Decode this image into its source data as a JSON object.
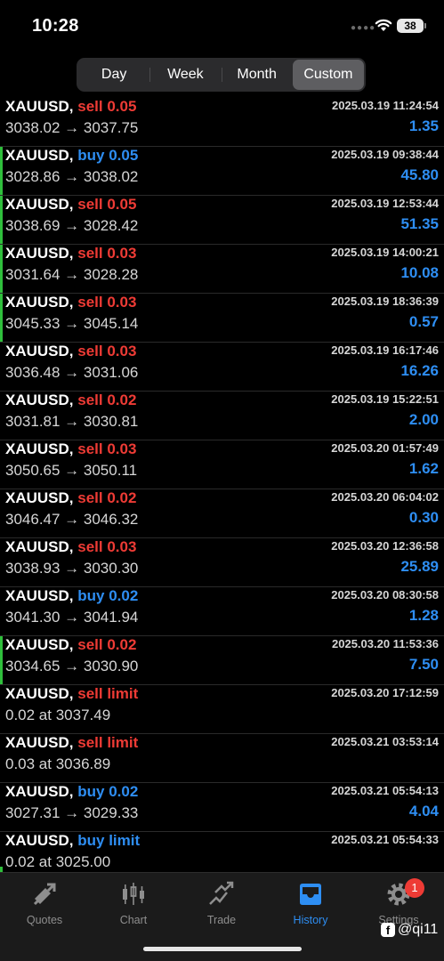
{
  "status": {
    "time": "10:28",
    "battery": "38"
  },
  "filters": [
    {
      "label": "Day",
      "active": false
    },
    {
      "label": "Week",
      "active": false
    },
    {
      "label": "Month",
      "active": false
    },
    {
      "label": "Custom",
      "active": true
    }
  ],
  "trades": [
    {
      "symbol": "XAUUSD,",
      "side": "sell",
      "side_text": "sell 0.05",
      "detail": "3038.02 → 3037.75",
      "time": "2025.03.19 11:24:54",
      "profit": "1.35",
      "flag": false
    },
    {
      "symbol": "XAUUSD,",
      "side": "buy",
      "side_text": "buy 0.05",
      "detail": "3028.86 → 3038.02",
      "time": "2025.03.19 09:38:44",
      "profit": "45.80",
      "flag": true
    },
    {
      "symbol": "XAUUSD,",
      "side": "sell",
      "side_text": "sell 0.05",
      "detail": "3038.69 → 3028.42",
      "time": "2025.03.19 12:53:44",
      "profit": "51.35",
      "flag": true
    },
    {
      "symbol": "XAUUSD,",
      "side": "sell",
      "side_text": "sell 0.03",
      "detail": "3031.64 → 3028.28",
      "time": "2025.03.19 14:00:21",
      "profit": "10.08",
      "flag": true
    },
    {
      "symbol": "XAUUSD,",
      "side": "sell",
      "side_text": "sell 0.03",
      "detail": "3045.33 → 3045.14",
      "time": "2025.03.19 18:36:39",
      "profit": "0.57",
      "flag": true
    },
    {
      "symbol": "XAUUSD,",
      "side": "sell",
      "side_text": "sell 0.03",
      "detail": "3036.48 → 3031.06",
      "time": "2025.03.19 16:17:46",
      "profit": "16.26",
      "flag": false
    },
    {
      "symbol": "XAUUSD,",
      "side": "sell",
      "side_text": "sell 0.02",
      "detail": "3031.81 → 3030.81",
      "time": "2025.03.19 15:22:51",
      "profit": "2.00",
      "flag": false
    },
    {
      "symbol": "XAUUSD,",
      "side": "sell",
      "side_text": "sell 0.03",
      "detail": "3050.65 → 3050.11",
      "time": "2025.03.20 01:57:49",
      "profit": "1.62",
      "flag": false
    },
    {
      "symbol": "XAUUSD,",
      "side": "sell",
      "side_text": "sell 0.02",
      "detail": "3046.47 → 3046.32",
      "time": "2025.03.20 06:04:02",
      "profit": "0.30",
      "flag": false
    },
    {
      "symbol": "XAUUSD,",
      "side": "sell",
      "side_text": "sell 0.03",
      "detail": "3038.93 → 3030.30",
      "time": "2025.03.20 12:36:58",
      "profit": "25.89",
      "flag": false
    },
    {
      "symbol": "XAUUSD,",
      "side": "buy",
      "side_text": "buy 0.02",
      "detail": "3041.30 → 3041.94",
      "time": "2025.03.20 08:30:58",
      "profit": "1.28",
      "flag": false
    },
    {
      "symbol": "XAUUSD,",
      "side": "sell",
      "side_text": "sell 0.02",
      "detail": "3034.65 → 3030.90",
      "time": "2025.03.20 11:53:36",
      "profit": "7.50",
      "flag": true
    },
    {
      "symbol": "XAUUSD,",
      "side": "sell",
      "side_text": "sell limit",
      "detail": "0.02 at 3037.49",
      "time": "2025.03.20 17:12:59",
      "profit": "",
      "flag": false
    },
    {
      "symbol": "XAUUSD,",
      "side": "sell",
      "side_text": "sell limit",
      "detail": "0.03 at 3036.89",
      "time": "2025.03.21 03:53:14",
      "profit": "",
      "flag": false
    },
    {
      "symbol": "XAUUSD,",
      "side": "buy",
      "side_text": "buy 0.02",
      "detail": "3027.31 → 3029.33",
      "time": "2025.03.21 05:54:13",
      "profit": "4.04",
      "flag": false
    },
    {
      "symbol": "XAUUSD,",
      "side": "buy",
      "side_text": "buy limit",
      "detail": "0.02 at 3025.00",
      "time": "2025.03.21 05:54:33",
      "profit": "",
      "flag": false
    }
  ],
  "tabs": [
    {
      "label": "Quotes",
      "icon": "quotes-icon",
      "active": false
    },
    {
      "label": "Chart",
      "icon": "chart-icon",
      "active": false
    },
    {
      "label": "Trade",
      "icon": "trade-icon",
      "active": false
    },
    {
      "label": "History",
      "icon": "history-icon",
      "active": true
    },
    {
      "label": "Settings",
      "icon": "settings-icon",
      "active": false,
      "badge": "1"
    }
  ],
  "watermark": {
    "handle": "@qi11",
    "icon": "facebook-icon"
  },
  "colors": {
    "sell": "#ee3b35",
    "buy": "#2e8ef3",
    "profit": "#2e8ef3",
    "flag": "#2fbf3c",
    "active_tab": "#2e8ef3"
  }
}
